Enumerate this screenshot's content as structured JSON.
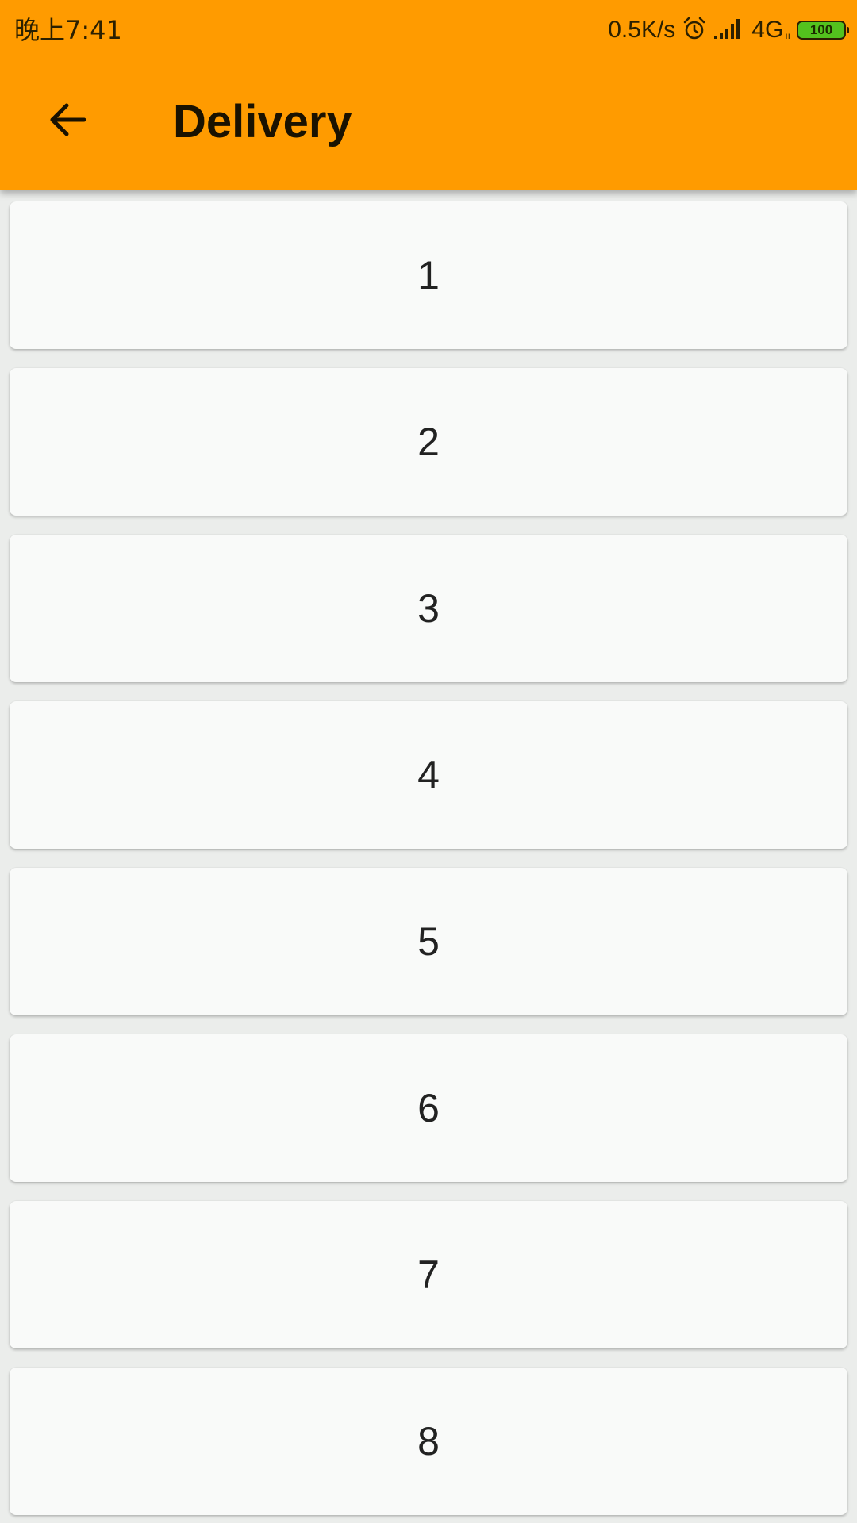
{
  "status_bar": {
    "time": "晚上7:41",
    "net_speed": "0.5K/s",
    "alarm_icon": "alarm-clock-icon",
    "signal_icon": "signal-bars-icon",
    "network": "4G",
    "network_sub": "ıı",
    "battery_level": "100",
    "battery_color": "#53c21e"
  },
  "toolbar": {
    "back_icon": "arrow-left-icon",
    "title": "Delivery",
    "color": "#ff9b00"
  },
  "list": {
    "items": [
      {
        "label": "1"
      },
      {
        "label": "2"
      },
      {
        "label": "3"
      },
      {
        "label": "4"
      },
      {
        "label": "5"
      },
      {
        "label": "6"
      },
      {
        "label": "7"
      },
      {
        "label": "8"
      }
    ]
  }
}
